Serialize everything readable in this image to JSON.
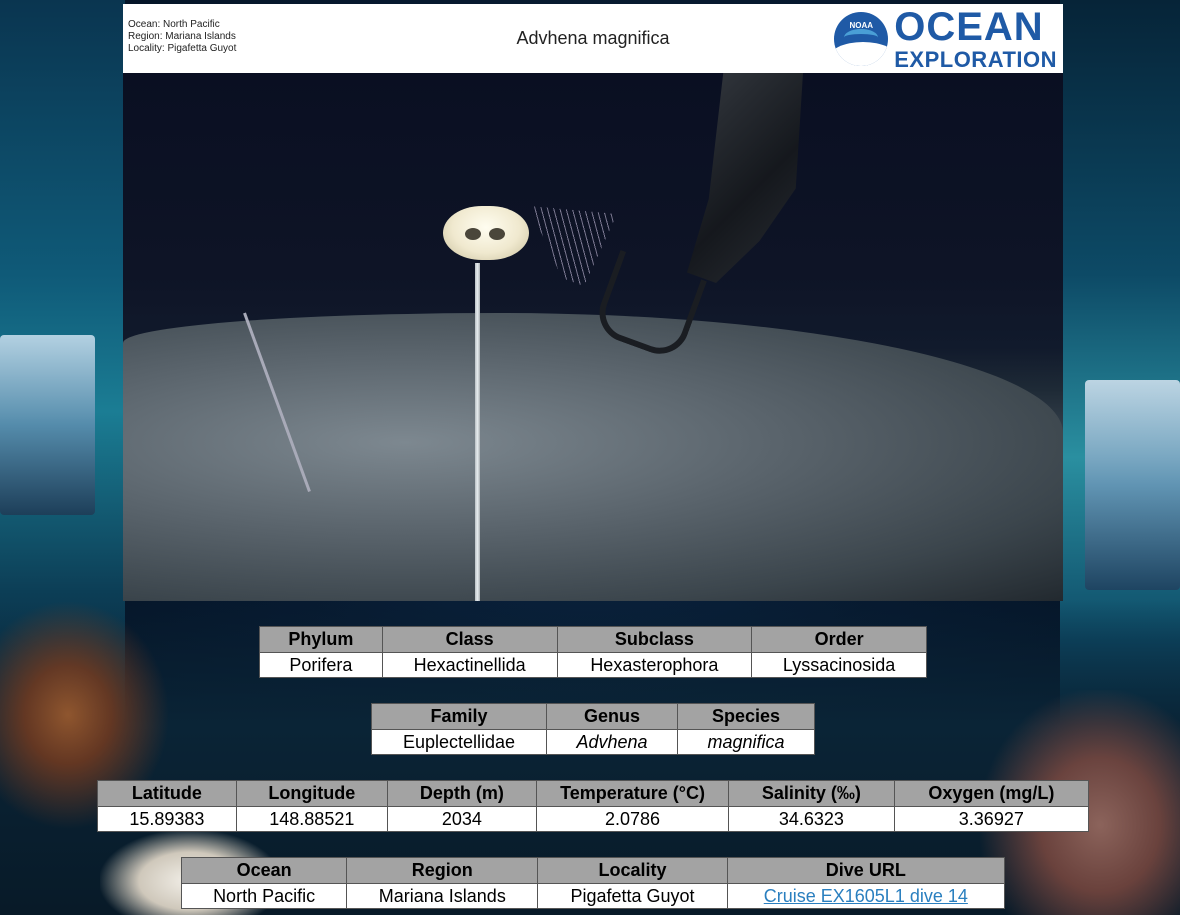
{
  "header": {
    "location_lines": [
      "Ocean: North Pacific",
      "Region: Mariana Islands",
      "Locality: Pigafetta Guyot"
    ],
    "species_title": "Advhena magnifica",
    "logo": {
      "badge_text": "NOAA",
      "line1": "OCEAN",
      "line2": "EXPLORATION",
      "brand_color": "#1f5aa6"
    }
  },
  "taxonomy_upper": {
    "headers": [
      "Phylum",
      "Class",
      "Subclass",
      "Order"
    ],
    "values": [
      "Porifera",
      "Hexactinellida",
      "Hexasterophora",
      "Lyssacinosida"
    ]
  },
  "taxonomy_lower": {
    "headers": [
      "Family",
      "Genus",
      "Species"
    ],
    "values": [
      "Euplectellidae",
      "Advhena",
      "magnifica"
    ]
  },
  "measurements": {
    "headers": [
      "Latitude",
      "Longitude",
      "Depth (m)",
      "Temperature (°C)",
      "Salinity (‰)",
      "Oxygen (mg/L)"
    ],
    "values": [
      "15.89383",
      "148.88521",
      "2034",
      "2.0786",
      "34.6323",
      "3.36927"
    ]
  },
  "location": {
    "headers": [
      "Ocean",
      "Region",
      "Locality",
      "Dive URL"
    ],
    "values": [
      "North Pacific",
      "Mariana Islands",
      "Pigafetta Guyot"
    ],
    "dive_link_text": "Cruise EX1605L1 dive 14"
  },
  "colors": {
    "header_cell": "#a3a3a3",
    "link": "#2a7fbf"
  }
}
